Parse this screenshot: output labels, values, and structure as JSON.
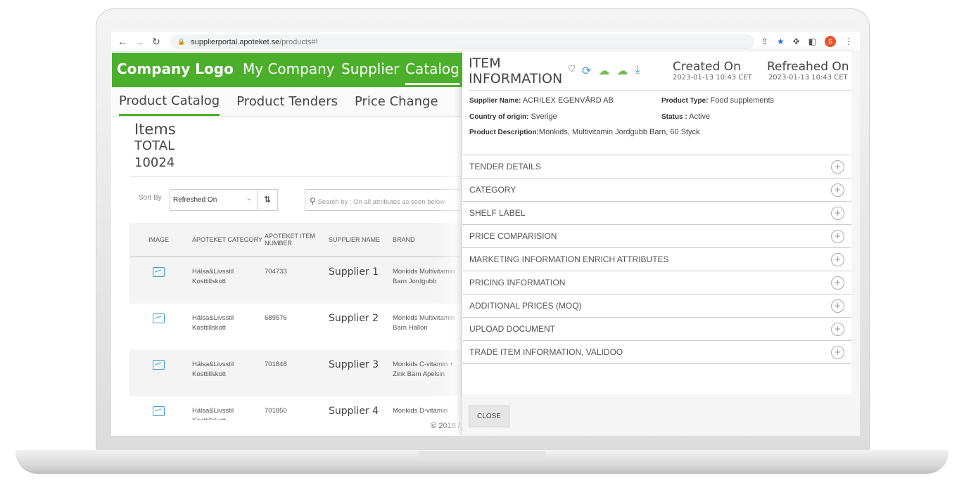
{
  "browser": {
    "url_host": "supplierportal.apoteket.se",
    "url_path": "/products#!",
    "avatar": "S"
  },
  "nav": {
    "logo": "Company Logo",
    "items": [
      "My Company",
      "Supplier",
      "Catalog"
    ]
  },
  "subnav": [
    "Product Catalog",
    "Product Tenders",
    "Price Change"
  ],
  "items": {
    "title": "Items",
    "total_label": "TOTAL",
    "total": "10024"
  },
  "sort": {
    "label": "Sort By",
    "value": "Refreshed On",
    "search_placeholder": "Search by : On all attributes as seen below"
  },
  "table": {
    "headers": [
      "IMAGE",
      "APOTEKET CATEGORY",
      "APOTEKET ITEM NUMBER",
      "SUPPLIER NAME",
      "BRAND"
    ],
    "rows": [
      {
        "category": "Hälsa&Livsstil Kosttillskott",
        "number": "704733",
        "supplier": "Supplier 1",
        "brand": "Monkids Multivitamin Barn Jordgubb"
      },
      {
        "category": "Hälsa&Livsstil Kosttillskott",
        "number": "689576",
        "supplier": "Supplier 2",
        "brand": "Monkids Multivitamin Barn Hallon"
      },
      {
        "category": "Hälsa&Livsstil Kosttillskott",
        "number": "701848",
        "supplier": "Supplier 3",
        "brand": "Monkids C-vitamin + Zink Barn Apelsin"
      },
      {
        "category": "Hälsa&Livsstil Kosttillskott",
        "number": "701850",
        "supplier": "Supplier 4",
        "brand": "Monkids D-vitamin"
      }
    ]
  },
  "footer": "© 2018 /",
  "modal": {
    "title": "ITEM INFORMATION",
    "created_label": "Created On",
    "created": "2023-01-13 10:43 CET",
    "refreshed_label": "Refreahed On",
    "refreshed": "2023-01-13 10:43 CET",
    "supplier_label": "Supplier Name:",
    "supplier": "ACRILEX EGENVÅRD AB",
    "type_label": "Product Type:",
    "type": "Food supplements",
    "country_label": "Country of origin:",
    "country": "Sverige",
    "status_label": "Status :",
    "status": "Active",
    "desc_label": "Product Description:",
    "desc": "Monkids, Multivitamin Jordgubb Barn, 60 Styck",
    "sections": [
      "TENDER DETAILS",
      "CATEGORY",
      "SHELF LABEL",
      "PRICE COMPARISION",
      "MARKETING INFORMATION ENRICH ATTRIBUTES",
      "PRICING INFORMATION",
      "ADDITIONAL PRICES (MOQ)",
      "UPLOAD DOCUMENT",
      "TRADE ITEM INFORMATION, VALIDOO"
    ],
    "close": "CLOSE"
  }
}
